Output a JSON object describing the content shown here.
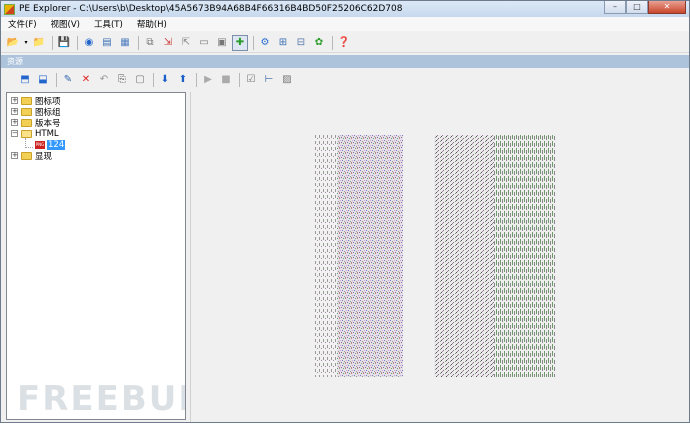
{
  "window": {
    "title": "PE Explorer - C:\\Users\\b\\Desktop\\45A5673B94A68B4F66316B4BD50F25206C62D708",
    "controls": {
      "minimize": "–",
      "maximize": "□",
      "close": "✕"
    }
  },
  "menu": [
    "文件(F)",
    "视图(V)",
    "工具(T)",
    "帮助(H)"
  ],
  "panel_header": "资源",
  "tree": {
    "items": [
      {
        "label": "图标项",
        "expander": "+"
      },
      {
        "label": "图标组",
        "expander": "+"
      },
      {
        "label": "版本号",
        "expander": "+"
      },
      {
        "label": "HTML",
        "expander": "−"
      },
      {
        "label": "124",
        "icon_text": "PNG"
      },
      {
        "label": "显现",
        "expander": "+"
      }
    ]
  },
  "watermark": "FREEBUF",
  "colors": {
    "selection": "#3399ff",
    "panel_header": "#adc3dc",
    "folder": "#f2cf55"
  }
}
